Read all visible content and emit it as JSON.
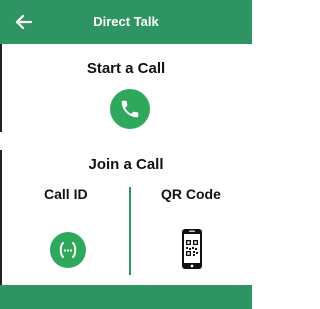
{
  "header": {
    "title": "Direct Talk",
    "back_icon": "arrow-left-icon",
    "color": "#2e9464"
  },
  "start": {
    "heading": "Start a Call",
    "icon": "phone-icon",
    "icon_color": "#2ea85b"
  },
  "join": {
    "heading": "Join a Call",
    "call_id_label": "Call ID",
    "call_id_icon": "dialpad-bracket-icon",
    "qr_label": "QR Code",
    "qr_icon": "qr-phone-icon"
  },
  "footer": {
    "color": "#2e9464"
  }
}
